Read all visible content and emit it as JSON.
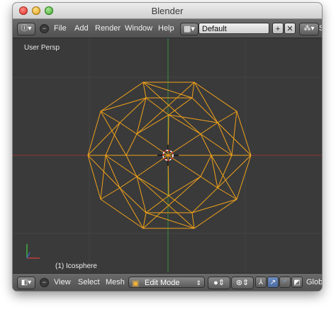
{
  "window": {
    "title": "Blender"
  },
  "header": {
    "editor_icon": "info-icon",
    "menus": [
      "File",
      "Add",
      "Render",
      "Window",
      "Help"
    ],
    "layout_name": "Default",
    "scene_trunc": "S"
  },
  "viewport": {
    "view_label": "User Persp",
    "object_label": "(1) Icosphere",
    "mesh_color": "#f0a21a",
    "grid_color": "#4a4a4a",
    "x_axis_color": "#9a3a3a",
    "y_axis_color": "#3a8a3a",
    "background": "#3a3a3a"
  },
  "footer": {
    "editor_icon": "cube-icon",
    "menus": [
      "View",
      "Select",
      "Mesh"
    ],
    "mode": "Edit Mode",
    "global_trunc": "Globa"
  }
}
